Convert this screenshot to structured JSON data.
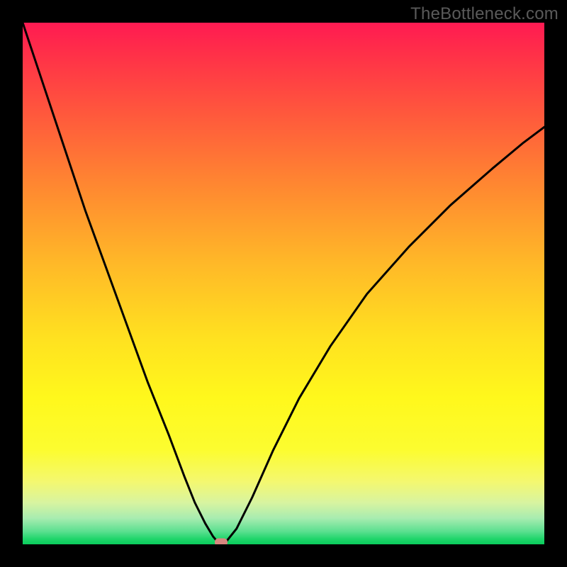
{
  "watermark": "TheBottleneck.com",
  "colors": {
    "frame": "#000000",
    "top": "#ff1a52",
    "mid": "#ffe020",
    "bottom": "#0acc5c",
    "curve": "#000000",
    "marker": "#d8877f"
  },
  "chart_data": {
    "type": "line",
    "title": "",
    "xlabel": "",
    "ylabel": "",
    "xlim": [
      0,
      100
    ],
    "ylim": [
      0,
      100
    ],
    "grid": false,
    "legend": false,
    "annotations": [
      {
        "type": "marker",
        "x": 38,
        "y": 0,
        "shape": "rounded-rect"
      }
    ],
    "series": [
      {
        "name": "left-branch",
        "x": [
          0,
          4,
          8,
          12,
          16,
          20,
          24,
          28,
          31,
          33,
          35,
          36.5,
          37.5,
          38
        ],
        "y": [
          100,
          88,
          76,
          64,
          53,
          42,
          31,
          21,
          13,
          8,
          4,
          1.5,
          0.3,
          0
        ]
      },
      {
        "name": "right-branch",
        "x": [
          38,
          39,
          41,
          44,
          48,
          53,
          59,
          66,
          74,
          82,
          90,
          96,
          100
        ],
        "y": [
          0,
          0.5,
          3,
          9,
          18,
          28,
          38,
          48,
          57,
          65,
          72,
          77,
          80
        ]
      }
    ],
    "notes": "V-shaped bottleneck curve; minimum at x≈38; background is vertical gradient red→yellow→green indicating severity (top=high, bottom=low)."
  }
}
